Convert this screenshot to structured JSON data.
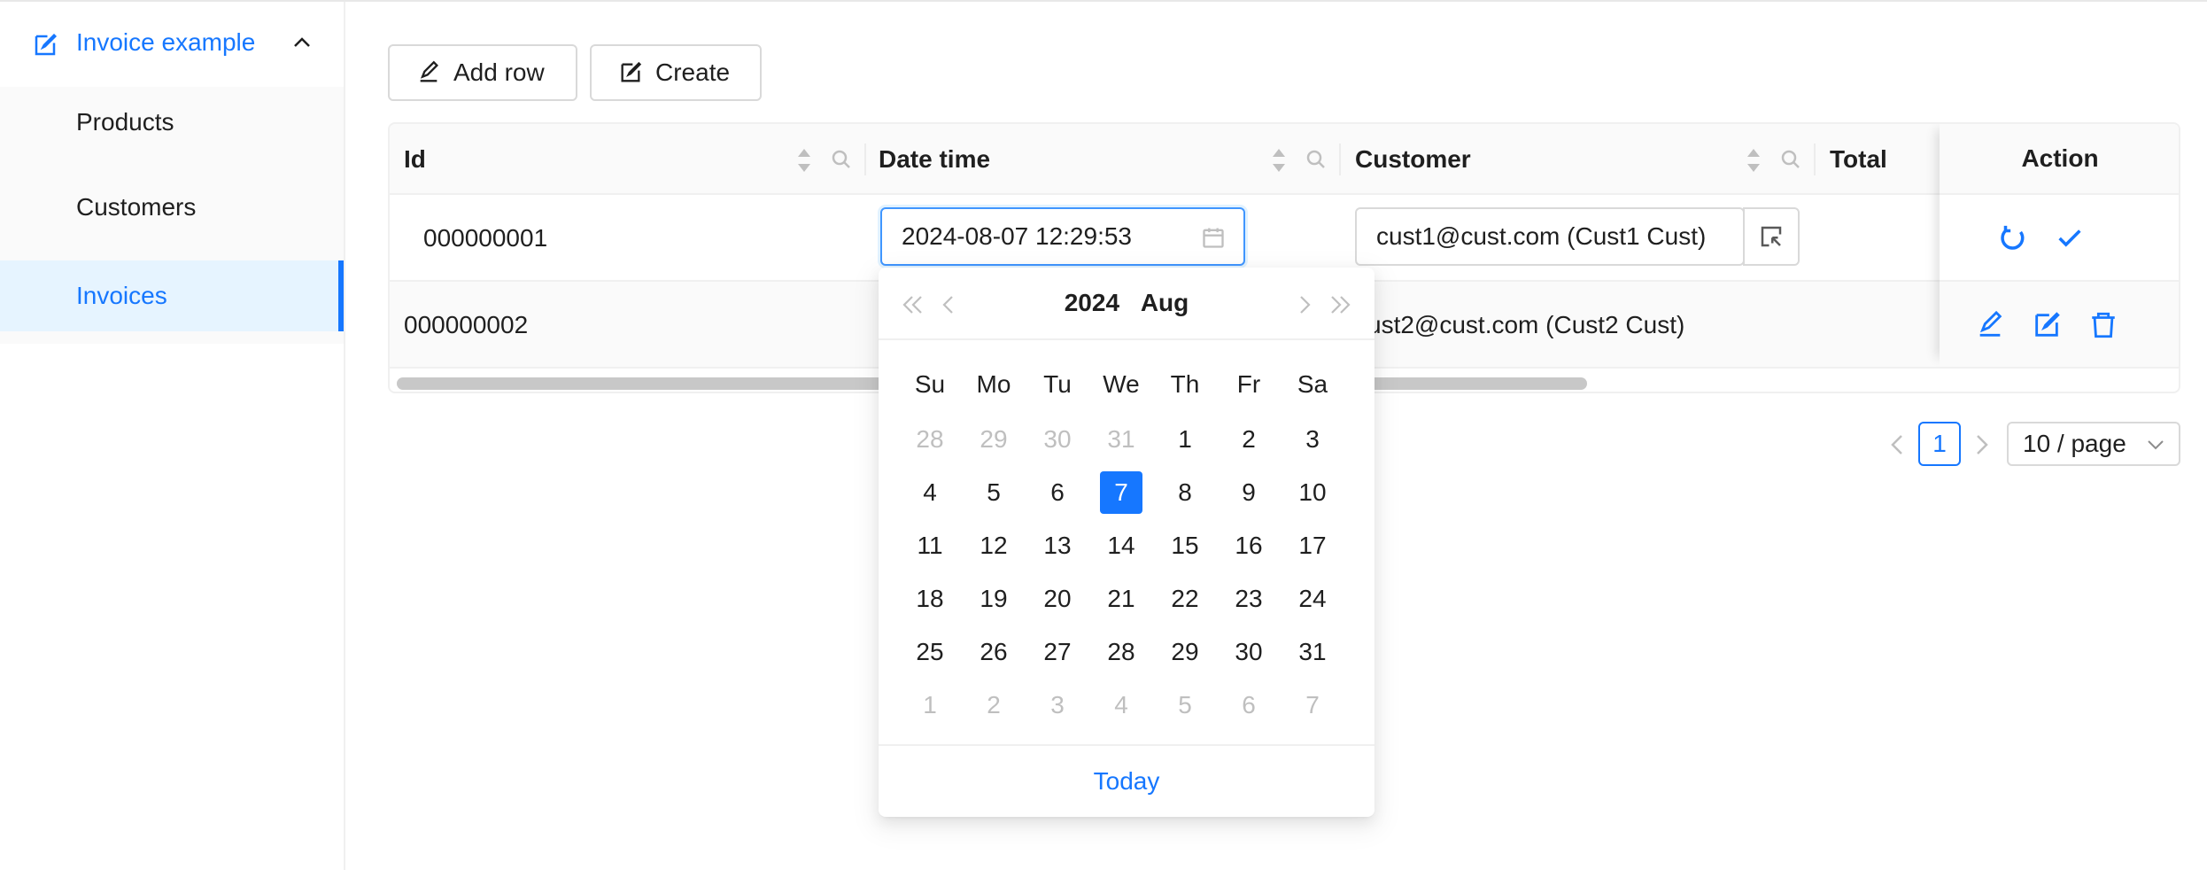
{
  "sidebar": {
    "group_label": "Invoice example",
    "items": [
      {
        "label": "Products"
      },
      {
        "label": "Customers"
      },
      {
        "label": "Invoices"
      }
    ]
  },
  "toolbar": {
    "add_row_label": "Add row",
    "create_label": "Create"
  },
  "table": {
    "columns": [
      "Id",
      "Date time",
      "Customer",
      "Total",
      "Action"
    ],
    "rows": [
      {
        "id": "000000001",
        "datetime": "2024-08-07 12:29:53",
        "customer": "cust1@cust.com (Cust1 Cust)"
      },
      {
        "id": "000000002",
        "customer": "ust2@cust.com (Cust2 Cust)"
      }
    ]
  },
  "pagination": {
    "current_page": "1",
    "page_size": "10 / page"
  },
  "datepicker": {
    "year": "2024",
    "month": "Aug",
    "weekdays": [
      "Su",
      "Mo",
      "Tu",
      "We",
      "Th",
      "Fr",
      "Sa"
    ],
    "days": [
      [
        "28",
        "29",
        "30",
        "31",
        "1",
        "2",
        "3"
      ],
      [
        "4",
        "5",
        "6",
        "7",
        "8",
        "9",
        "10"
      ],
      [
        "11",
        "12",
        "13",
        "14",
        "15",
        "16",
        "17"
      ],
      [
        "18",
        "19",
        "20",
        "21",
        "22",
        "23",
        "24"
      ],
      [
        "25",
        "26",
        "27",
        "28",
        "29",
        "30",
        "31"
      ],
      [
        "1",
        "2",
        "3",
        "4",
        "5",
        "6",
        "7"
      ]
    ],
    "selected_day": "7",
    "today_label": "Today"
  },
  "colors": {
    "accent": "#1677ff",
    "muted_day": "#bfbfbf",
    "header_bg": "#fafafa",
    "active_menu_bg": "#e6f4ff"
  }
}
